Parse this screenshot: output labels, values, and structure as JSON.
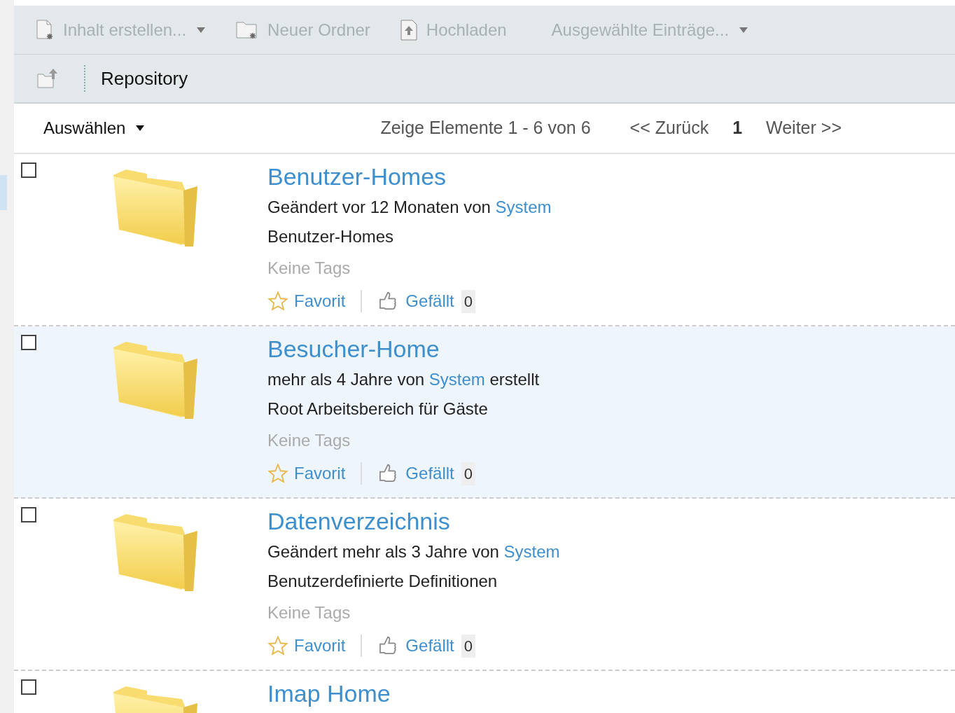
{
  "toolbar": {
    "actions": [
      {
        "label": "Inhalt erstellen...",
        "kind": "create",
        "dropdown": true,
        "disabled": true
      },
      {
        "label": "Neuer Ordner",
        "kind": "folder",
        "dropdown": false,
        "disabled": true
      },
      {
        "label": "Hochladen",
        "kind": "upload",
        "dropdown": false,
        "disabled": true
      },
      {
        "label": "Ausgewählte Einträge...",
        "kind": "selection",
        "dropdown": true,
        "disabled": true
      }
    ]
  },
  "breadcrumb": {
    "current": "Repository"
  },
  "list_header": {
    "select_label": "Auswählen",
    "range": "Zeige Elemente 1 - 6 von 6",
    "prev": "<< Zurück",
    "page": "1",
    "next": "Weiter >>"
  },
  "items": [
    {
      "title": "Benutzer-Homes",
      "checked": false,
      "highlighted": false,
      "meta": {
        "before": "Geändert vor 12 Monaten von ",
        "user": "System"
      },
      "description": "Benutzer-Homes",
      "tags": "Keine Tags",
      "favorite": "Favorit",
      "like": "Gefällt",
      "like_count": "0"
    },
    {
      "title": "Besucher-Home",
      "checked": false,
      "highlighted": true,
      "meta": {
        "before": "mehr als 4 Jahre von ",
        "user": "System",
        "after": " erstellt"
      },
      "description": "Root Arbeitsbereich für Gäste",
      "tags": "Keine Tags",
      "favorite": "Favorit",
      "like": "Gefällt",
      "like_count": "0"
    },
    {
      "title": "Datenverzeichnis",
      "checked": false,
      "highlighted": false,
      "meta": {
        "before": "Geändert mehr als 3 Jahre von ",
        "user": "System"
      },
      "description": "Benutzerdefinierte Definitionen",
      "tags": "Keine Tags",
      "favorite": "Favorit",
      "like": "Gefällt",
      "like_count": "0"
    },
    {
      "title": "Imap Home",
      "checked": false,
      "highlighted": false
    }
  ]
}
